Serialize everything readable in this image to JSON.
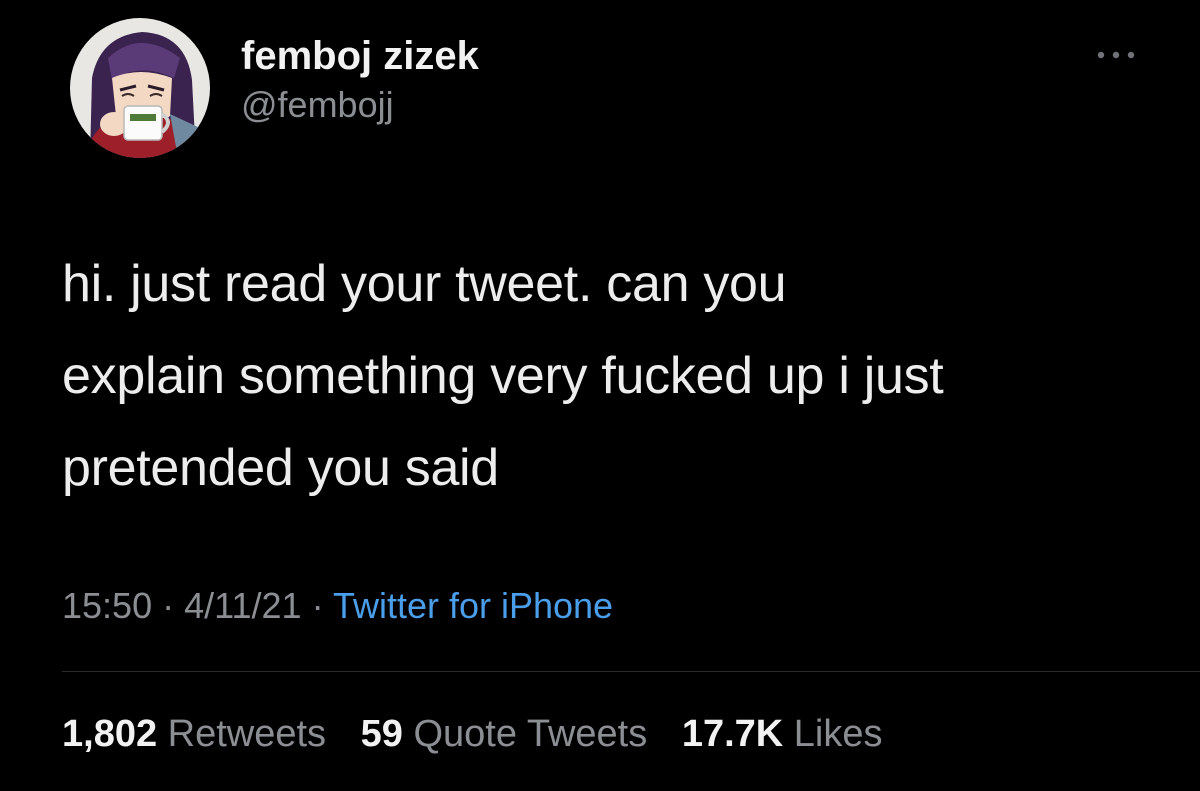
{
  "author": {
    "display_name": "femboj zizek",
    "handle": "@fembojj",
    "avatar_icon": "anime-character-avatar"
  },
  "more_icon": "more-options-icon",
  "tweet": {
    "text_lines": [
      "hi. just read your tweet. can you",
      "explain something very fucked up i just",
      "pretended you said"
    ],
    "time": "15:50",
    "date": "4/11/21",
    "separator": "·",
    "source": "Twitter for iPhone"
  },
  "stats": {
    "retweets": {
      "count": "1,802",
      "label": "Retweets"
    },
    "quotes": {
      "count": "59",
      "label": "Quote Tweets"
    },
    "likes": {
      "count": "17.7K",
      "label": "Likes"
    }
  },
  "colors": {
    "background": "#000000",
    "text": "#ededed",
    "secondary": "#8b8f94",
    "link": "#4a9eea"
  }
}
